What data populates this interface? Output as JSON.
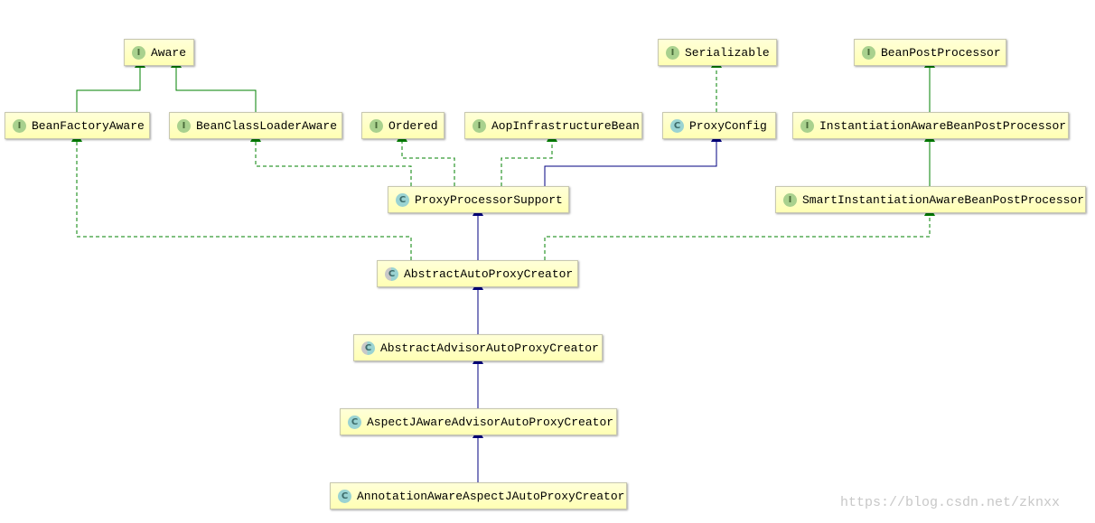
{
  "colors": {
    "interface_edge": "#008000",
    "class_edge": "#000080",
    "node_fill": "#ffffc8",
    "interface_icon": "#a9d18e",
    "class_icon": "#9ad3d2"
  },
  "nodes": [
    {
      "id": "Aware",
      "label": "Aware",
      "kind": "interface"
    },
    {
      "id": "BeanFactoryAware",
      "label": "BeanFactoryAware",
      "kind": "interface"
    },
    {
      "id": "BeanClassLoaderAware",
      "label": "BeanClassLoaderAware",
      "kind": "interface"
    },
    {
      "id": "Ordered",
      "label": "Ordered",
      "kind": "interface"
    },
    {
      "id": "AopInfrastructureBean",
      "label": "AopInfrastructureBean",
      "kind": "interface"
    },
    {
      "id": "ProxyConfig",
      "label": "ProxyConfig",
      "kind": "class"
    },
    {
      "id": "Serializable",
      "label": "Serializable",
      "kind": "interface"
    },
    {
      "id": "BeanPostProcessor",
      "label": "BeanPostProcessor",
      "kind": "interface"
    },
    {
      "id": "InstantiationAwareBeanPostProcessor",
      "label": "InstantiationAwareBeanPostProcessor",
      "kind": "interface"
    },
    {
      "id": "ProxyProcessorSupport",
      "label": "ProxyProcessorSupport",
      "kind": "class"
    },
    {
      "id": "SmartInstantiationAwareBeanPostProcessor",
      "label": "SmartInstantiationAwareBeanPostProcessor",
      "kind": "interface"
    },
    {
      "id": "AbstractAutoProxyCreator",
      "label": "AbstractAutoProxyCreator",
      "kind": "abstract"
    },
    {
      "id": "AbstractAdvisorAutoProxyCreator",
      "label": "AbstractAdvisorAutoProxyCreator",
      "kind": "abstract"
    },
    {
      "id": "AspectJAwareAdvisorAutoProxyCreator",
      "label": "AspectJAwareAdvisorAutoProxyCreator",
      "kind": "class"
    },
    {
      "id": "AnnotationAwareAspectJAutoProxyCreator",
      "label": "AnnotationAwareAspectJAutoProxyCreator",
      "kind": "class"
    }
  ],
  "icon_letters": {
    "interface": "I",
    "class": "C",
    "abstract": "C"
  },
  "edges": [
    {
      "from": "BeanFactoryAware",
      "to": "Aware",
      "type": "extends"
    },
    {
      "from": "BeanClassLoaderAware",
      "to": "Aware",
      "type": "extends"
    },
    {
      "from": "ProxyConfig",
      "to": "Serializable",
      "type": "implements"
    },
    {
      "from": "InstantiationAwareBeanPostProcessor",
      "to": "BeanPostProcessor",
      "type": "extends"
    },
    {
      "from": "ProxyProcessorSupport",
      "to": "BeanClassLoaderAware",
      "type": "implements"
    },
    {
      "from": "ProxyProcessorSupport",
      "to": "Ordered",
      "type": "implements"
    },
    {
      "from": "ProxyProcessorSupport",
      "to": "AopInfrastructureBean",
      "type": "implements"
    },
    {
      "from": "ProxyProcessorSupport",
      "to": "ProxyConfig",
      "type": "extends"
    },
    {
      "from": "SmartInstantiationAwareBeanPostProcessor",
      "to": "InstantiationAwareBeanPostProcessor",
      "type": "extends"
    },
    {
      "from": "AbstractAutoProxyCreator",
      "to": "BeanFactoryAware",
      "type": "implements"
    },
    {
      "from": "AbstractAutoProxyCreator",
      "to": "ProxyProcessorSupport",
      "type": "extends"
    },
    {
      "from": "AbstractAutoProxyCreator",
      "to": "SmartInstantiationAwareBeanPostProcessor",
      "type": "implements"
    },
    {
      "from": "AbstractAdvisorAutoProxyCreator",
      "to": "AbstractAutoProxyCreator",
      "type": "extends"
    },
    {
      "from": "AspectJAwareAdvisorAutoProxyCreator",
      "to": "AbstractAdvisorAutoProxyCreator",
      "type": "extends"
    },
    {
      "from": "AnnotationAwareAspectJAutoProxyCreator",
      "to": "AspectJAwareAdvisorAutoProxyCreator",
      "type": "extends"
    }
  ],
  "watermark": "https://blog.csdn.net/zknxx"
}
